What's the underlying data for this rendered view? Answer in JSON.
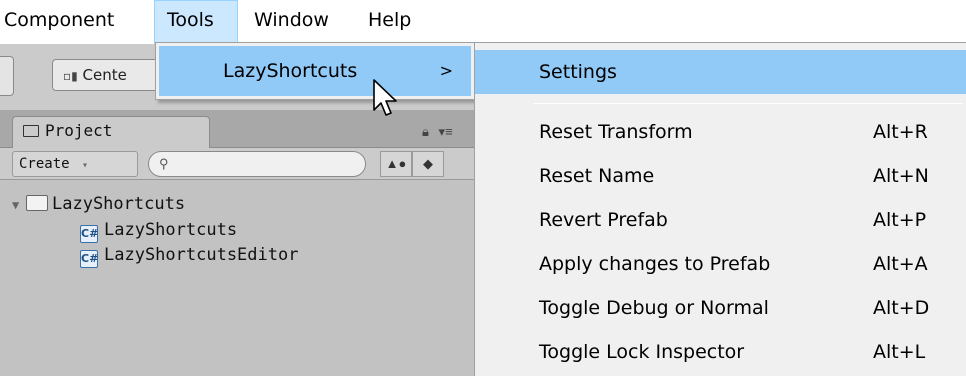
{
  "menubar": {
    "items": [
      {
        "label": "Component"
      },
      {
        "label": "Tools"
      },
      {
        "label": "Window"
      },
      {
        "label": "Help"
      }
    ],
    "active": "Tools"
  },
  "toolbar": {
    "center_label": "Cente"
  },
  "project_panel": {
    "tab_label": "Project",
    "create_label": "Create",
    "search_placeholder": "",
    "tree": [
      {
        "label": "LazyShortcuts",
        "type": "folder",
        "expanded": true
      },
      {
        "label": "LazyShortcuts",
        "type": "cs-script"
      },
      {
        "label": "LazyShortcutsEditor",
        "type": "cs-script"
      }
    ]
  },
  "tools_menu": {
    "item_label": "LazyShortcuts",
    "chevron": ">"
  },
  "submenu": {
    "items": [
      {
        "label": "Settings",
        "shortcut": ""
      },
      {
        "label": "Reset Transform",
        "shortcut": "Alt+R"
      },
      {
        "label": "Reset Name",
        "shortcut": "Alt+N"
      },
      {
        "label": "Revert Prefab",
        "shortcut": "Alt+P"
      },
      {
        "label": "Apply changes to Prefab",
        "shortcut": "Alt+A"
      },
      {
        "label": "Toggle Debug or Normal",
        "shortcut": "Alt+D"
      },
      {
        "label": "Toggle Lock Inspector",
        "shortcut": "Alt+L"
      }
    ]
  },
  "colors": {
    "highlight": "#91c9f7",
    "menu_bg": "#f0f0f0",
    "panel_bg": "#c2c2c2"
  }
}
